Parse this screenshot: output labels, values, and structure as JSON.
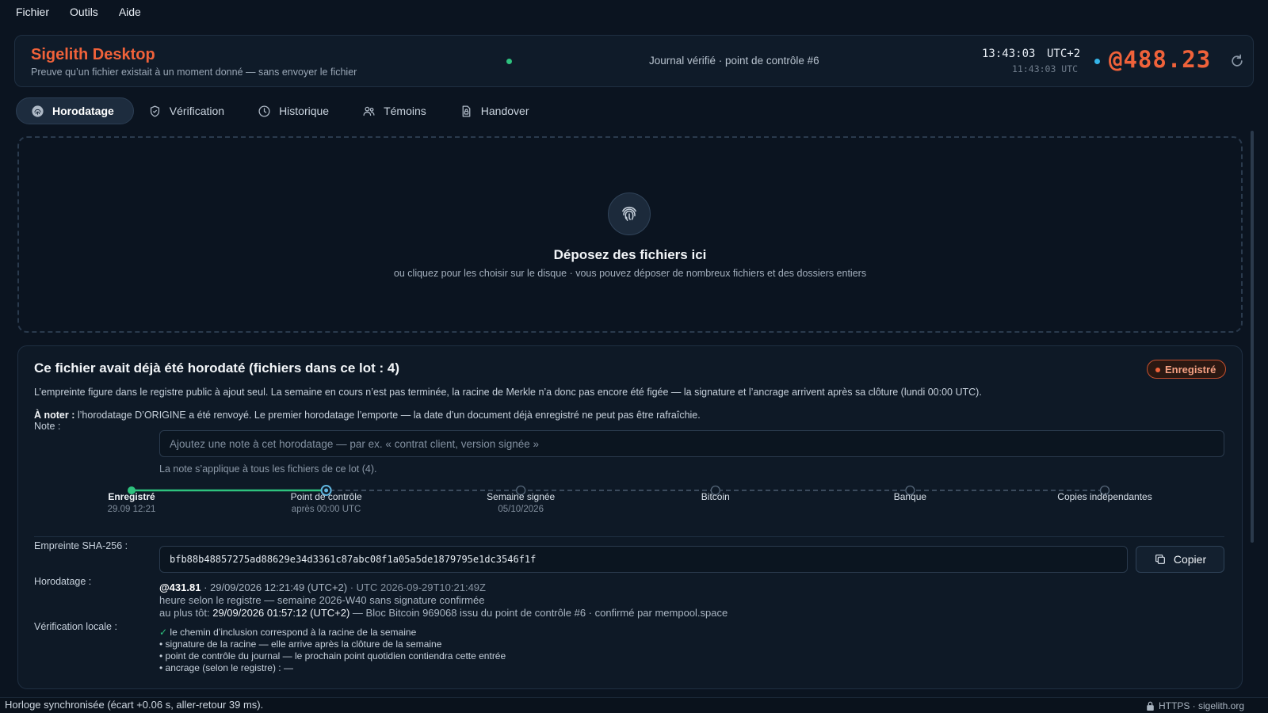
{
  "menu": {
    "file": "Fichier",
    "tools": "Outils",
    "help": "Aide"
  },
  "header": {
    "title": "Sigelith Desktop",
    "subtitle": "Preuve qu’un fichier existait à un moment donné — sans envoyer le fichier",
    "journal_status": "Journal vérifié · point de contrôle #6",
    "local_time": "13:43:03",
    "timezone": "UTC+2",
    "utc_time": "11:43:03 UTC",
    "beat_time": "@488.23",
    "status_color": "#2ec27e",
    "accent_color": "#f0623a"
  },
  "tabs": [
    {
      "label": "Horodatage",
      "icon": "fingerprint-icon",
      "active": true
    },
    {
      "label": "Vérification",
      "icon": "shield-check-icon"
    },
    {
      "label": "Historique",
      "icon": "clock-icon"
    },
    {
      "label": "Témoins",
      "icon": "users-icon"
    },
    {
      "label": "Handover",
      "icon": "lock-document-icon"
    }
  ],
  "dropzone": {
    "title": "Déposez des fichiers ici",
    "subtitle": "ou cliquez pour les choisir sur le disque · vous pouvez déposer de nombreux fichiers et des dossiers entiers"
  },
  "result": {
    "title": "Ce fichier avait déjà été horodaté (fichiers dans ce lot : 4)",
    "badge": "Enregistré",
    "paragraph": "L’empreinte figure dans le registre public à ajout seul. La semaine en cours n’est pas terminée, la racine de Merkle n’a donc pas encore été figée — la signature et l’ancrage arrivent après sa clôture (lundi 00:00 UTC).",
    "notice_label": "À noter :",
    "notice_text": " l’horodatage D’ORIGINE a été renvoyé. Le premier horodatage l’emporte — la date d’un document déjà enregistré ne peut pas être rafraîchie.",
    "note_label": "Note :",
    "note_placeholder": "Ajoutez une note à cet horodatage — par ex. « contrat client, version signée »",
    "note_value": "",
    "note_hint": "La note s’applique à tous les fichiers de ce lot (4).",
    "steps": [
      {
        "label": "Enregistré",
        "sub": "29.09 12:21",
        "state": "done"
      },
      {
        "label": "Point de contrôle",
        "sub": "après 00:00 UTC",
        "state": "current"
      },
      {
        "label": "Semaine signée",
        "sub": "05/10/2026",
        "state": "pending"
      },
      {
        "label": "Bitcoin",
        "sub": "",
        "state": "pending"
      },
      {
        "label": "Banque",
        "sub": "",
        "state": "pending"
      },
      {
        "label": "Copies indépendantes",
        "sub": "",
        "state": "pending"
      }
    ],
    "hash_label": "Empreinte SHA-256 :",
    "hash_value": "bfb88b48857275ad88629e34d3361c87abc08f1a05a5de1879795e1dc3546f1f",
    "copy_label": "Copier",
    "timestamp_label": "Horodatage :",
    "ts_beat": "@431.81",
    "ts_local": " · 29/09/2026 12:21:49 (UTC+2) ",
    "ts_utc": "· UTC 2026-09-29T10:21:49Z",
    "ts_line2": "heure selon le registre — semaine 2026-W40 sans signature confirmée",
    "ts_line3_prefix": "au plus tôt: ",
    "ts_line3_time": "29/09/2026 01:57:12 (UTC+2)",
    "ts_line3_rest": " — Bloc Bitcoin 969068 issu du point de contrôle #6 · confirmé par mempool.space",
    "local_check_label": "Vérification locale :",
    "checks": [
      {
        "mark": "✓",
        "text": " le chemin d’inclusion correspond à la racine de la semaine"
      },
      {
        "mark": "•",
        "text": " signature de la racine — elle arrive après la clôture de la semaine"
      },
      {
        "mark": "•",
        "text": " point de contrôle du journal — le prochain point quotidien contiendra cette entrée"
      },
      {
        "mark": "•",
        "text": " ancrage (selon le registre) : —"
      }
    ]
  },
  "statusbar": {
    "left": "Horloge synchronisée (écart +0.06 s, aller-retour 39 ms).",
    "right": "HTTPS · sigelith.org"
  }
}
